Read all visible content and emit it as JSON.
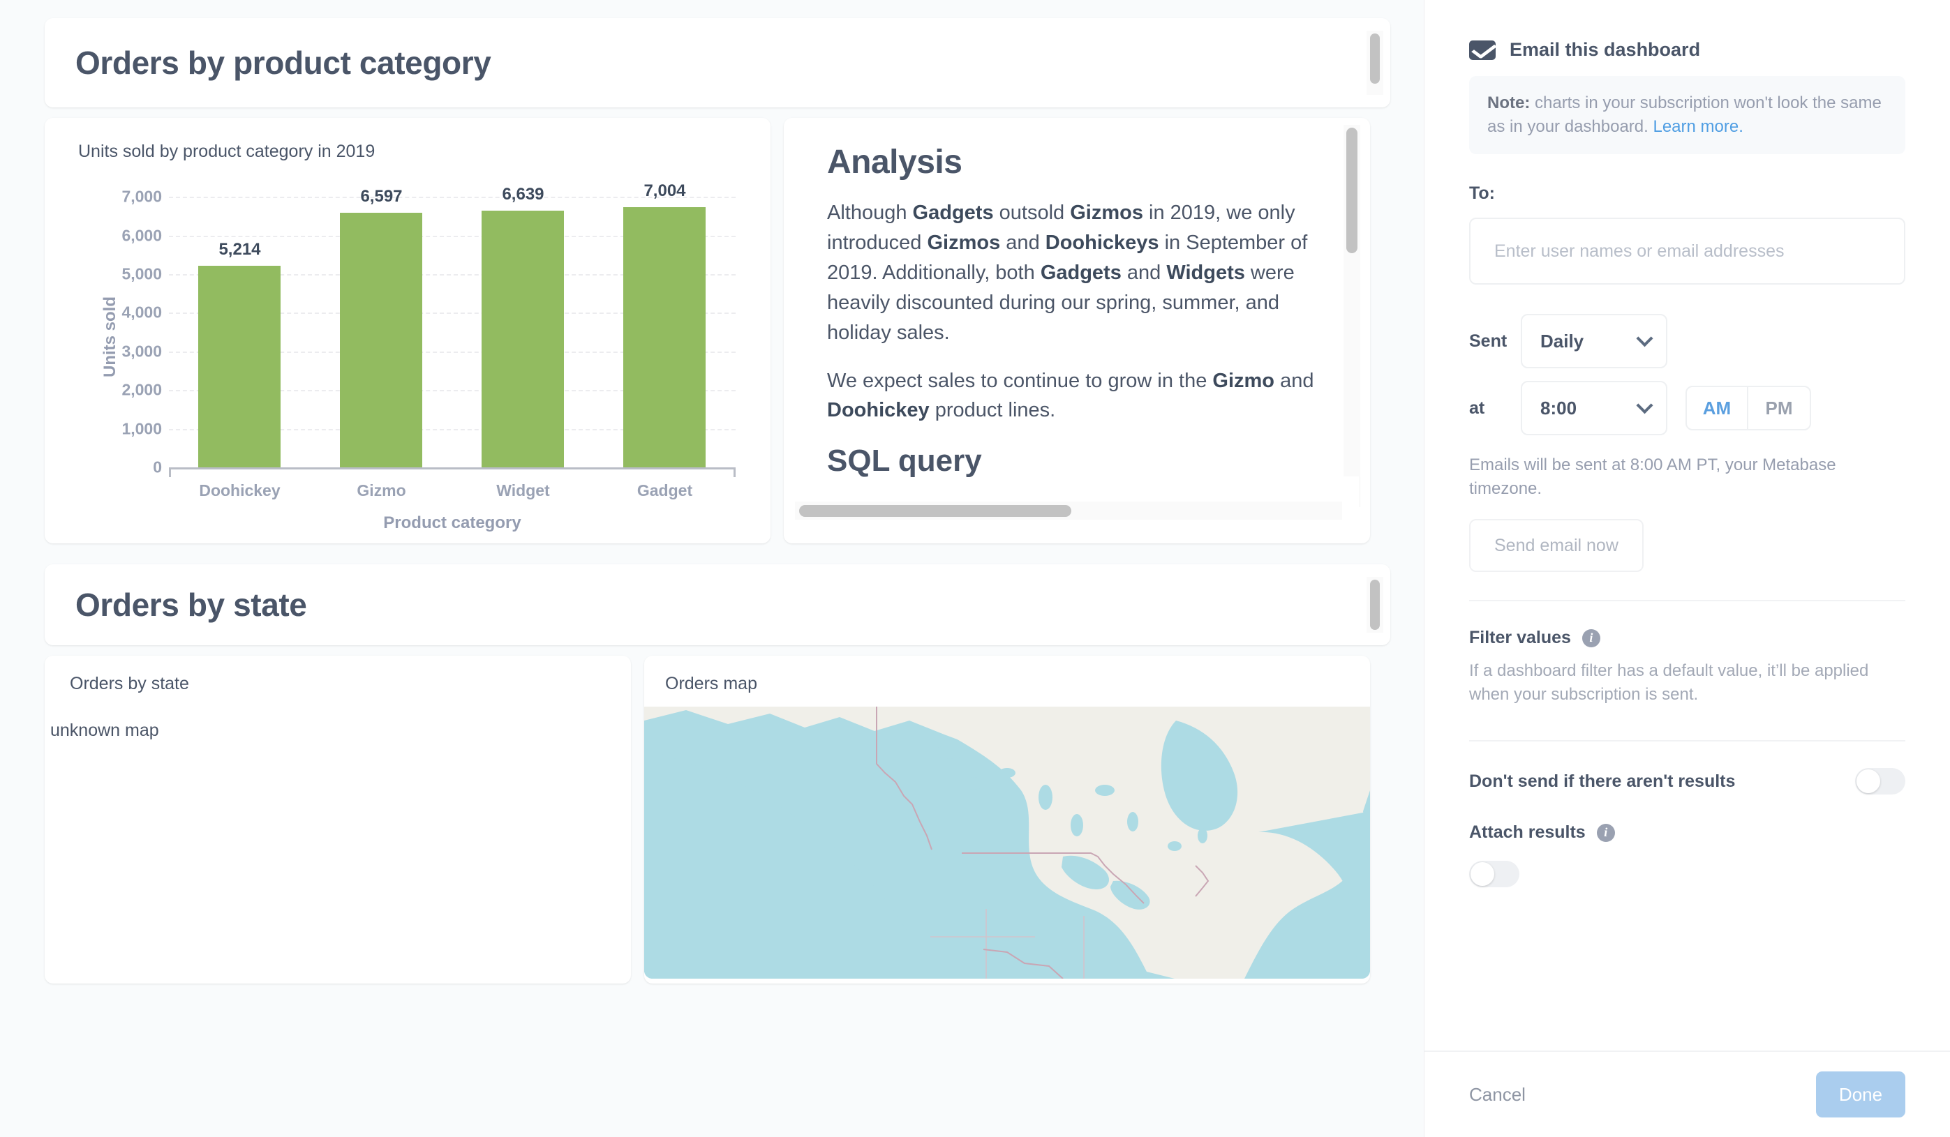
{
  "dashboard": {
    "section1_title": "Orders by product category",
    "section2_title": "Orders by state",
    "chart_card_title": "Units sold by product category in 2019",
    "analysis": {
      "heading": "Analysis",
      "para1_html": "Although <b>Gadgets</b> outsold <b>Gizmos</b> in 2019, we only introduced <b>Gizmos</b> and <b>Doohickeys</b> in September of 2019. Additionally, both <b>Gadgets</b> and <b>Widgets</b> were heavily discounted during our spring, summer, and holiday sales.",
      "para2_html": "We expect sales to continue to grow in the <b>Gizmo</b> and <b>Doohickey</b> product lines.",
      "heading2": "SQL query"
    },
    "state_card_title": "Orders by state",
    "state_card_body": "unknown map",
    "map_card_title": "Orders map"
  },
  "chart_data": {
    "type": "bar",
    "title": "Units sold by product category in 2019",
    "categories": [
      "Doohickey",
      "Gizmo",
      "Widget",
      "Gadget"
    ],
    "values": [
      5214,
      6597,
      6639,
      7004
    ],
    "value_labels": [
      "5,214",
      "6,597",
      "6,639",
      "7,004"
    ],
    "xlabel": "Product category",
    "ylabel": "Units sold",
    "ylim": [
      0,
      7400
    ],
    "yticks": [
      0,
      1000,
      2000,
      3000,
      4000,
      5000,
      6000,
      7000
    ],
    "ytick_labels": [
      "0",
      "1,000",
      "2,000",
      "3,000",
      "4,000",
      "5,000",
      "6,000",
      "7,000"
    ],
    "grid": true,
    "legend": false,
    "bar_color": "#92bb60"
  },
  "sidebar": {
    "title": "Email this dashboard",
    "note_prefix": "Note:",
    "note_text": " charts in your subscription won't look the same as in your dashboard. ",
    "note_link": "Learn more.",
    "to_label": "To:",
    "to_placeholder": "Enter user names or email addresses",
    "sent_label": "Sent",
    "sent_value": "Daily",
    "at_label": "at",
    "at_value": "8:00",
    "am_label": "AM",
    "pm_label": "PM",
    "timezone_note": "Emails will be sent at 8:00 AM PT, your Metabase timezone.",
    "send_now_label": "Send email now",
    "filter_values_title": "Filter values",
    "filter_values_desc": "If a dashboard filter has a default value, it’ll be applied when your subscription is sent.",
    "dont_send_label": "Don't send if there aren't results",
    "attach_results_label": "Attach results",
    "info_glyph": "i",
    "cancel_label": "Cancel",
    "done_label": "Done"
  },
  "colors": {
    "bar_green": "#92bb60",
    "accent_blue": "#509ee3",
    "done_blue": "#aacdee",
    "text_dark": "#4a5568",
    "map_water": "#addbe4",
    "map_land": "#f0efe9"
  }
}
